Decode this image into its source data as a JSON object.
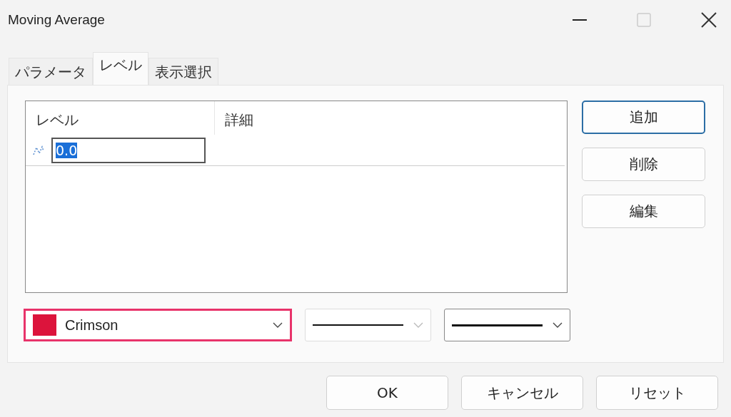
{
  "window": {
    "title": "Moving Average",
    "maximize_disabled": true
  },
  "tabs": [
    {
      "label": "パラメータ",
      "selected": false
    },
    {
      "label": "レベル",
      "selected": true
    },
    {
      "label": "表示選択",
      "selected": false
    }
  ],
  "levels_table": {
    "columns": [
      "レベル",
      "詳細"
    ],
    "rows": [
      {
        "value": "0.0",
        "editing": true
      }
    ]
  },
  "side_buttons": [
    {
      "label": "追加",
      "focused": true
    },
    {
      "label": "削除",
      "focused": false
    },
    {
      "label": "編集",
      "focused": false
    }
  ],
  "color_dropdown": {
    "value": "Crimson",
    "color": "#dc143c",
    "highlighted": true
  },
  "style_dropdown": {
    "disabled": true
  },
  "width_dropdown": {
    "disabled": false
  },
  "buttons": [
    "OK",
    "キャンセル",
    "リセット"
  ]
}
